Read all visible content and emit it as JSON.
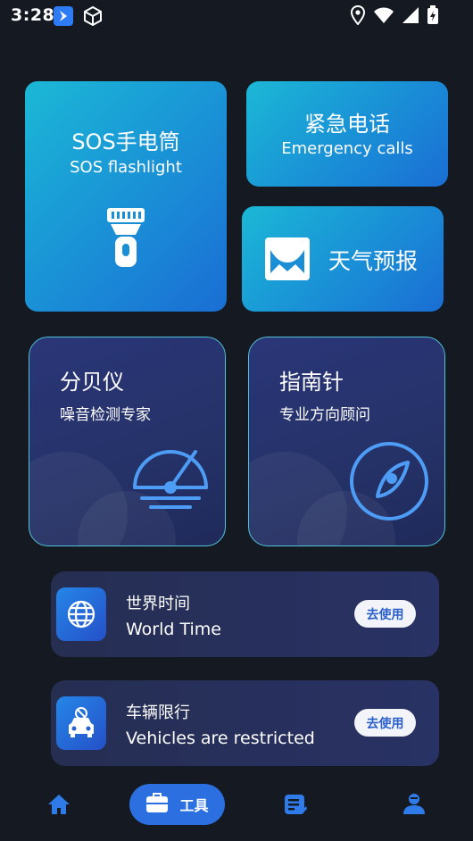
{
  "status_bar": {
    "time": "3:28"
  },
  "tiles": {
    "sos": {
      "title": "SOS手电筒",
      "subtitle": "SOS flashlight"
    },
    "emergency": {
      "title": "紧急电话",
      "subtitle": "Emergency calls"
    },
    "weather": {
      "title": "天气预报"
    }
  },
  "cards": {
    "decibel": {
      "title": "分贝仪",
      "subtitle": "噪音检测专家"
    },
    "compass": {
      "title": "指南针",
      "subtitle": "专业方向顾问"
    }
  },
  "list": [
    {
      "title": "世界时间",
      "subtitle": "World Time",
      "button": "去使用",
      "icon": "globe-icon"
    },
    {
      "title": "车辆限行",
      "subtitle": "Vehicles are restricted",
      "button": "去使用",
      "icon": "car-restricted-icon"
    }
  ],
  "nav": {
    "tools_label": "工具",
    "active": "tools"
  },
  "colors": {
    "background": "#151a22",
    "accent": "#2b6fe0",
    "tile_gradient_start": "#1bb8d6",
    "tile_gradient_end": "#1a6ed4",
    "card_border": "#4fc3d9"
  }
}
